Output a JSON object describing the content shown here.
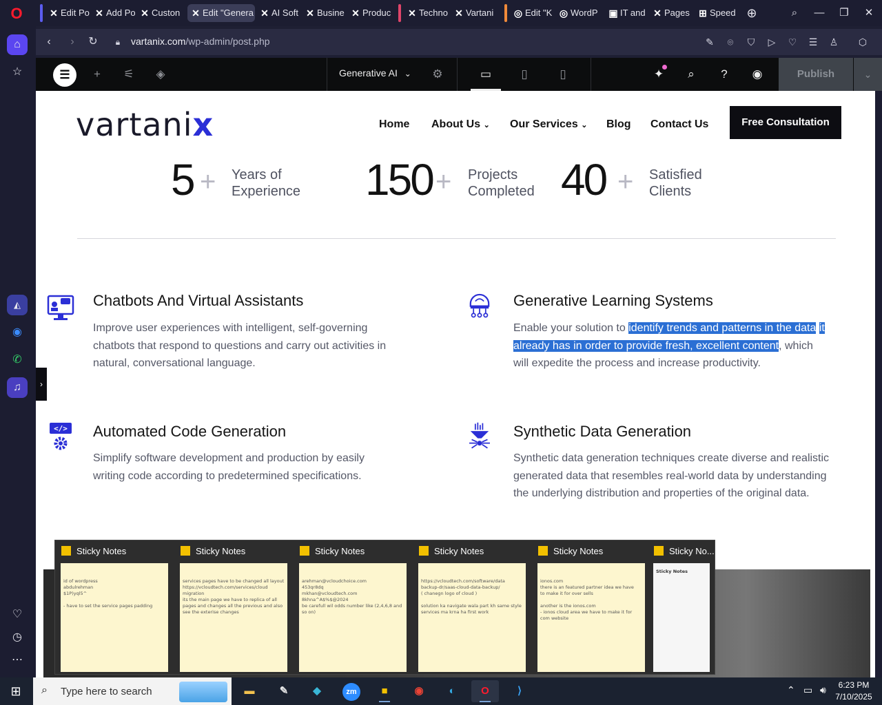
{
  "browser": {
    "tabs": [
      {
        "label": "Edit Po",
        "icon": "elementor-x-icon"
      },
      {
        "label": "Add Po",
        "icon": "elementor-x-icon"
      },
      {
        "label": "Custon",
        "icon": "elementor-x-icon"
      },
      {
        "label": "Edit \"Genera",
        "icon": "elementor-x-icon",
        "active": true
      },
      {
        "label": "AI Soft",
        "icon": "elementor-x-icon"
      },
      {
        "label": "Busine",
        "icon": "elementor-x-icon"
      },
      {
        "label": "Produc",
        "icon": "elementor-x-icon"
      },
      {
        "label": "Techno",
        "icon": "elementor-x-icon"
      },
      {
        "label": "Vartani",
        "icon": "elementor-x-icon"
      },
      {
        "label": "Edit \"K",
        "icon": "wordpress-icon"
      },
      {
        "label": "WordP",
        "icon": "wordpress-icon"
      },
      {
        "label": "IT and",
        "icon": "site-icon"
      },
      {
        "label": "Pages",
        "icon": "elementor-x-icon"
      },
      {
        "label": "Speed",
        "icon": "grid-icon"
      }
    ],
    "url_domain": "vartanix.com",
    "url_path": "/wp-admin/post.php"
  },
  "elementor": {
    "page_selector": "Generative AI",
    "publish_label": "Publish"
  },
  "site": {
    "logo_text": "vartani",
    "logo_accent": "x",
    "nav": [
      "Home",
      "About Us",
      "Our Services",
      "Blog",
      "Contact Us"
    ],
    "cta_label": "Free Consultation",
    "stats": [
      {
        "number": "5",
        "plus": "+",
        "label_line1": "Years of",
        "label_line2": "Experience"
      },
      {
        "number": "150",
        "plus": "+",
        "label_line1": "Projects",
        "label_line2": "Completed"
      },
      {
        "number": "40",
        "plus": "+",
        "label_line1": "Satisfied",
        "label_line2": "Clients"
      }
    ],
    "services": [
      {
        "title": "Chatbots And Virtual Assistants",
        "desc": "Improve user experiences with intelligent, self-governing chatbots that respond to questions and carry out activities in natural, conversational language."
      },
      {
        "title": "Generative Learning Systems",
        "desc_before": "Enable your solution to ",
        "desc_highlight_1": "identify trends and patterns in the data",
        "desc_highlight_2": "it already has in order to provide fresh, excellent content",
        "desc_after": ", which will expedite the process and increase productivity."
      },
      {
        "title": "Automated Code Generation",
        "desc": "Simplify software development and production by easily writing code according to predetermined specifications."
      },
      {
        "title": "Synthetic Data Generation",
        "desc": "Synthetic data generation techniques create diverse and realistic generated data that resembles real-world data by understanding the underlying distribution and properties of the original data."
      }
    ]
  },
  "sticky_notes": {
    "windows": [
      {
        "title": "Sticky Notes",
        "text": "id of wordpress\nabdulrehman\n$1P)yql5^\n\n- have to set the service pages padding"
      },
      {
        "title": "Sticky Notes",
        "text": "services pages have to be changed all layout\nhttps://vcloudtech.com/services/cloud\nmigration\nits the main page we have to replica of all\npages and changes all the previous and also\nsee the exterise changes"
      },
      {
        "title": "Sticky Notes",
        "text": "arehman@vcloudchoice.com\n453qr8dq\nmkhan@vcloudtech.com\n8khna^A$%$@2024\nbe carefull wil odds number like (2,4,6,8 and\nso on)"
      },
      {
        "title": "Sticky Notes",
        "text": "https://vcloudtech.com/software/data\nbackup-dr/saas-cloud-data-backup/\n( chanegn logo of cloud )\n\nsolution ka navigate wala part kh same style\nservices ma krna ha first work"
      },
      {
        "title": "Sticky Notes",
        "text": "ionos.com\nthere is an featured partner idea we have\nto make it for over sells\n\nanother is the ionos.com\n- ionos cloud area we have to make it for\ncom website"
      },
      {
        "title": "Sticky No...",
        "text": "Sticky Notes"
      }
    ]
  },
  "taskbar": {
    "search_placeholder": "Type here to search",
    "time": "6:23 PM",
    "date": "7/10/2025"
  }
}
